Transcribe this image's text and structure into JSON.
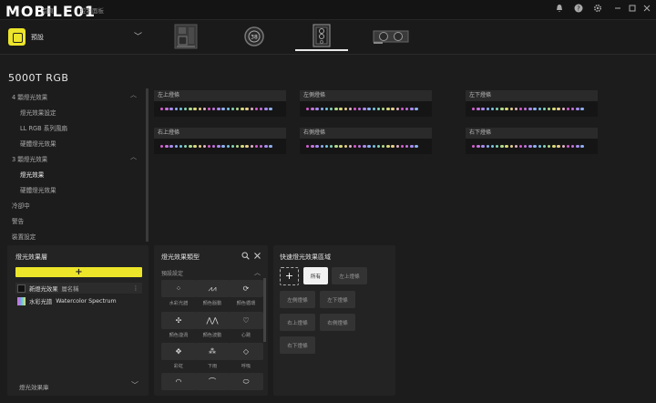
{
  "app": {
    "logo_text": "MOBILE01",
    "menu": [
      "首頁",
      "控制面板"
    ]
  },
  "window_controls": [
    "bell-icon",
    "help-icon",
    "gear-icon",
    "minimize-icon",
    "maximize-icon",
    "close-icon"
  ],
  "preset": {
    "label": "預設"
  },
  "devices": [
    {
      "name": "motherboard-icon",
      "active": false
    },
    {
      "name": "pump-icon",
      "active": false
    },
    {
      "name": "case-icon",
      "active": true
    },
    {
      "name": "gpu-icon",
      "active": false
    }
  ],
  "device_title": "5000T RGB",
  "sidebar": {
    "items": [
      {
        "label": "4 顆燈光效果",
        "level": 0,
        "chevron": "︿"
      },
      {
        "label": "燈光效果設定",
        "level": 1
      },
      {
        "label": "LL RGB 系列風扇",
        "level": 1
      },
      {
        "label": "硬體燈光效果",
        "level": 1
      },
      {
        "label": "3 顆燈光效果",
        "level": 0,
        "chevron": "︿"
      },
      {
        "label": "燈光效果",
        "level": 1,
        "active": true
      },
      {
        "label": "硬體燈光效果",
        "level": 1
      },
      {
        "label": "冷卻中",
        "level": 0
      },
      {
        "label": "警告",
        "level": 0
      },
      {
        "label": "裝置設定",
        "level": 0
      }
    ]
  },
  "strips": [
    {
      "label": "左上燈條"
    },
    {
      "label": "左側燈條"
    },
    {
      "label": "左下燈條"
    },
    {
      "label": "右上燈條"
    },
    {
      "label": "右側燈條"
    },
    {
      "label": "右下燈條"
    }
  ],
  "led_colors": [
    "#d65fd0",
    "#c774e0",
    "#a98cf0",
    "#8fb0f2",
    "#7bc6e0",
    "#86d6b9",
    "#b3dd8c",
    "#d9d97a",
    "#e7d08c",
    "#e3b4c8"
  ],
  "layers_panel": {
    "title": "燈光效果層",
    "add_symbol": "+",
    "layers": [
      {
        "name": "新燈光效果",
        "extra": "層名稱",
        "menu": "⋮"
      },
      {
        "name": "水彩光譜",
        "extra": "Watercolor Spectrum"
      }
    ],
    "footer": "燈光效果庫",
    "footer_chevron": "﹀"
  },
  "types_panel": {
    "title": "燈光效果類型",
    "section": "預設設定",
    "tiles": [
      {
        "icon": "⁘",
        "label": "水彩光譜"
      },
      {
        "icon": "⩘⩘",
        "label": "顏色脈動"
      },
      {
        "icon": "⟳",
        "label": "顏色循環"
      },
      {
        "icon": "✣",
        "label": "顏色漩渦"
      },
      {
        "icon": "⋀⋀",
        "label": "顏色波動"
      },
      {
        "icon": "♡",
        "label": "心跳"
      },
      {
        "icon": "✥",
        "label": "彩虹"
      },
      {
        "icon": "⁂",
        "label": "下雨"
      },
      {
        "icon": "◇",
        "label": "呼吸"
      },
      {
        "icon": "◠",
        "label": ""
      },
      {
        "icon": "⌒",
        "label": ""
      },
      {
        "icon": "⬭",
        "label": ""
      }
    ]
  },
  "zones_panel": {
    "title": "快速燈光效果區域",
    "add_symbol": "+",
    "zones": [
      {
        "label": "所有",
        "selected": true
      },
      {
        "label": "左上燈條"
      },
      {
        "label": "左側燈條"
      },
      {
        "label": "左下燈條"
      },
      {
        "label": "右上燈條"
      },
      {
        "label": "右側燈條"
      },
      {
        "label": "右下燈條"
      }
    ]
  }
}
